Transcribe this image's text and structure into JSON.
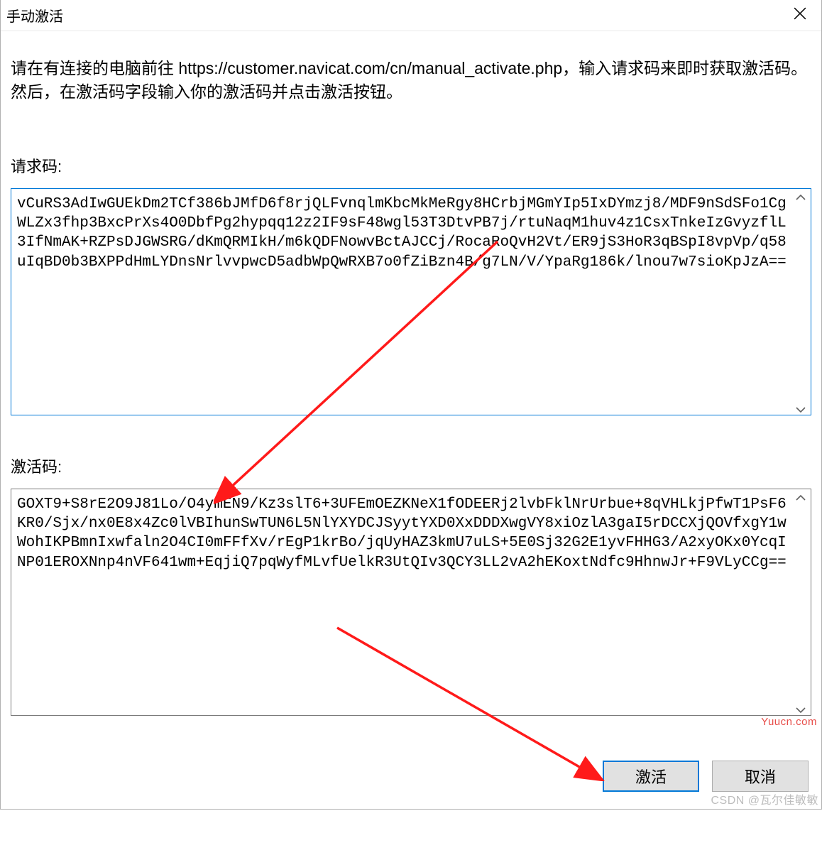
{
  "window": {
    "title": "手动激活"
  },
  "instructions": "请在有连接的电脑前往 https://customer.navicat.com/cn/manual_activate.php，输入请求码来即时获取激活码。然后，在激活码字段输入你的激活码并点击激活按钮。",
  "labels": {
    "request_code": "请求码:",
    "activate_code": "激活码:"
  },
  "fields": {
    "request_code": "vCuRS3AdIwGUEkDm2TCf386bJMfD6f8rjQLFvnqlmKbcMkMeRgy8HCrbjMGmYIp5IxDYmzj8/MDF9nSdSFo1CgWLZx3fhp3BxcPrXs4O0DbfPg2hypqq12z2IF9sF48wgl53T3DtvPB7j/rtuNaqM1huv4z1CsxTnkeIzGvyzflL3IfNmAK+RZPsDJGWSRG/dKmQRMIkH/m6kQDFNowvBctAJCCj/RocaRoQvH2Vt/ER9jS3HoR3qBSpI8vpVp/q58uIqBD0b3BXPPdHmLYDnsNrlvvpwcD5adbWpQwRXB7o0fZiBzn4B/g7LN/V/YpaRg186k/lnou7w7sioKpJzA==",
    "activate_code": "GOXT9+S8rE2O9J81Lo/O4ymEN9/Kz3slT6+3UFEmOEZKNeX1fODEERj2lvbFklNrUrbue+8qVHLkjPfwT1PsF6KR0/Sjx/nx0E8x4Zc0lVBIhunSwTUN6L5NlYXYDCJSyytYXD0XxDDDXwgVY8xiOzlA3gaI5rDCCXjQOVfxgY1wWohIKPBmnIxwfaln2O4CI0mFFfXv/rEgP1krBo/jqUyHAZ3kmU7uLS+5E0Sj32G2E1yvFHHG3/A2xyOKx0YcqINP01EROXNnp4nVF641wm+EqjiQ7pqWyfMLvfUelkR3UtQIv3QCY3LL2vA2hEKoxtNdfc9HhnwJr+F9VLyCCg=="
  },
  "buttons": {
    "activate": "激活",
    "cancel": "取消"
  },
  "watermark": {
    "right": "Yuucn.com",
    "bottom": "CSDN @瓦尔佳敏敏"
  }
}
